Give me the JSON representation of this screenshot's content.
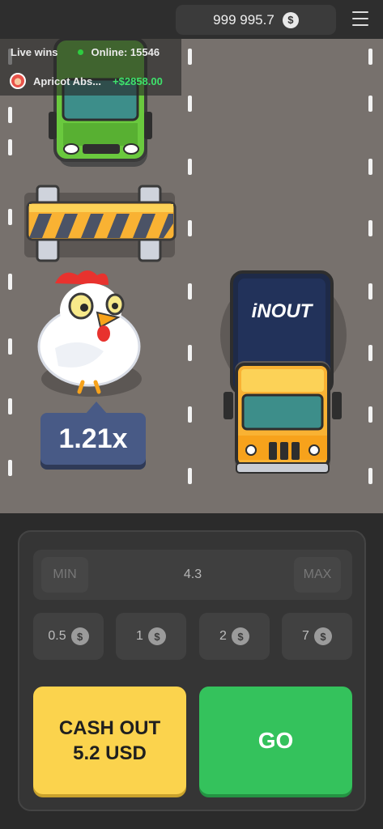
{
  "header": {
    "balance": "999 995.7",
    "currency_icon": "dollar-coin-icon",
    "menu_icon": "hamburger-menu-icon"
  },
  "live_wins": {
    "label": "Live wins",
    "online": "Online: 15546",
    "last_win_user": "Apricot Abs...",
    "last_win_amount": "+$2858.00"
  },
  "game": {
    "multiplier": "1.21x",
    "truck_brand": "iNOUT"
  },
  "controls": {
    "min_label": "MIN",
    "max_label": "MAX",
    "stake_value": "4.3",
    "chips": [
      "0.5",
      "1",
      "2",
      "7"
    ],
    "cash_out_line1": "CASH OUT",
    "cash_out_line2": "5.2 USD",
    "go_label": "GO"
  },
  "colors": {
    "road": "#77716d",
    "cash_out": "#fbd34d",
    "go": "#34c25c",
    "multiplier_bg": "#485a86",
    "win_green": "#3ee26b"
  }
}
